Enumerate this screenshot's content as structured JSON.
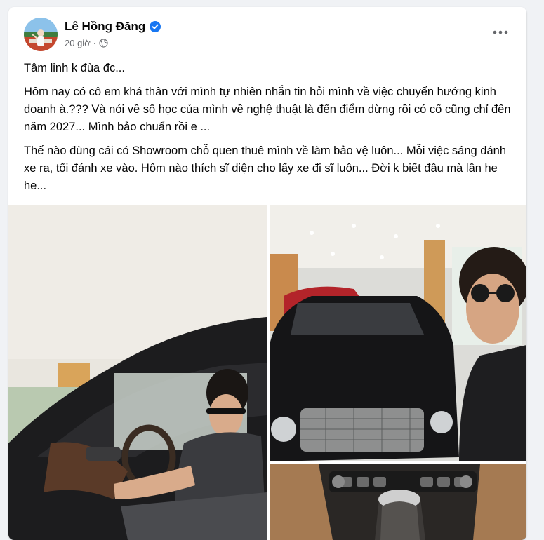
{
  "post": {
    "author": "Lê Hồng Đăng",
    "time": "20 giờ",
    "separator": "·",
    "verified_icon": "verified-badge-icon",
    "privacy_icon": "globe-icon",
    "more_icon": "more-options-icon",
    "paragraphs": [
      "Tâm linh k đùa đc...",
      "Hôm nay có cô em khá thân với mình tự nhiên nhắn tin hỏi mình về việc chuyển hướng kinh doanh à.??? Và nói về số học của mình về nghệ thuật là đến điểm dừng rồi có cố cũng chỉ đến năm 2027... Mình bảo chuẩn rồi e ...",
      "Thế nào đùng cái có Showroom chỗ quen thuê mình về làm bảo vệ luôn... Mỗi việc sáng đánh xe ra, tối đánh xe vào. Hôm nào thích sĩ diện cho lấy xe đi sĩ luôn... Đời k biết đâu mà lần he he..."
    ]
  },
  "colors": {
    "accent": "#1877f2",
    "secondary_text": "#65676b",
    "background": "#f0f2f5"
  }
}
